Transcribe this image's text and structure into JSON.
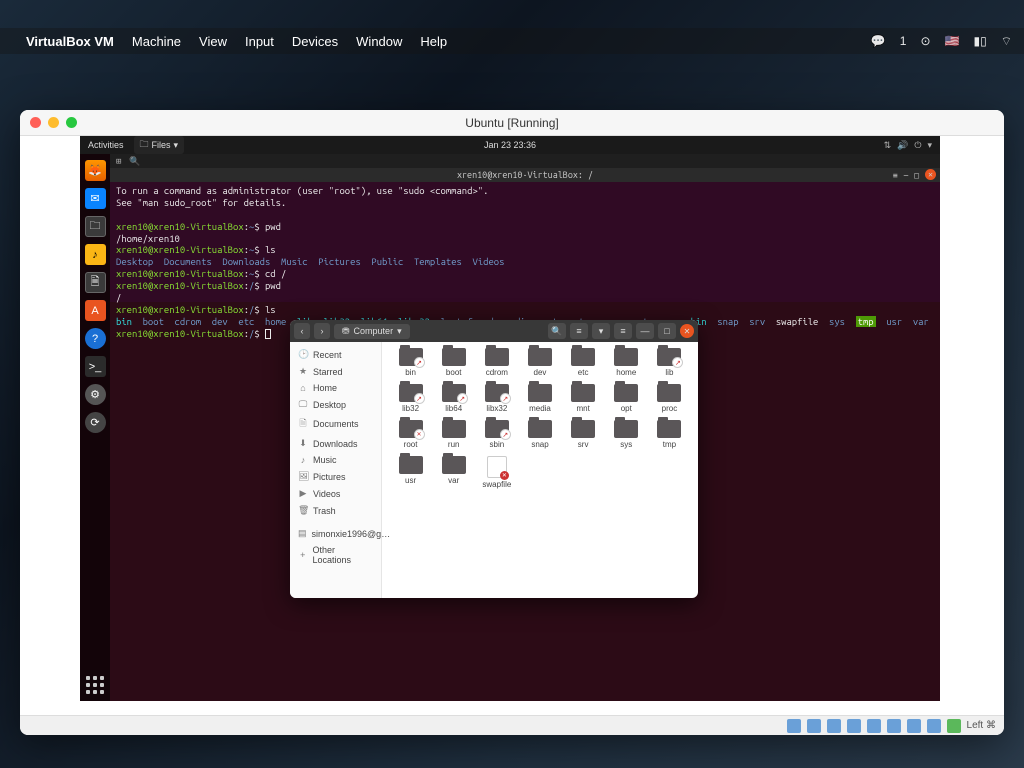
{
  "mac_menu": {
    "app": "VirtualBox VM",
    "items": [
      "Machine",
      "View",
      "Input",
      "Devices",
      "Window",
      "Help"
    ],
    "right_badge": "1"
  },
  "vbox": {
    "title": "Ubuntu [Running]",
    "status_hostkey": "Left ⌘"
  },
  "gnome": {
    "activities": "Activities",
    "files_btn": "Files",
    "clock": "Jan 23  23:36"
  },
  "terminal": {
    "title": "xren10@xren10-VirtualBox: /",
    "hint1": "To run a command as administrator (user \"root\"), use \"sudo <command>\".",
    "hint2": "See \"man sudo_root\" for details.",
    "prompt_userhost": "xren10@xren10-VirtualBox",
    "home_path": "~",
    "root_path": "/",
    "cmd_pwd": "pwd",
    "out_home": "/home/xren10",
    "cmd_ls": "ls",
    "ls_home": [
      "Desktop",
      "Documents",
      "Downloads",
      "Music",
      "Pictures",
      "Public",
      "Templates",
      "Videos"
    ],
    "cmd_cdroot": "cd /",
    "out_root": "/",
    "ls_root_ln": [
      "bin",
      "boot",
      "cdrom",
      "dev",
      "etc"
    ],
    "ls_root_home": "home",
    "ls_root_ln2": [
      "lib",
      "lib32",
      "lib64",
      "libx32"
    ],
    "ls_root_dir": [
      "lost+found",
      "media",
      "mnt",
      "opt",
      "proc",
      "root",
      "run"
    ],
    "ls_root_ln3": "sbin",
    "ls_root_dir2": [
      "snap",
      "srv"
    ],
    "ls_root_swap": "swapfile",
    "ls_root_dir3": "sys",
    "ls_root_tmp": "tmp",
    "ls_root_dir4": [
      "usr",
      "var"
    ]
  },
  "files": {
    "path_label": "Computer",
    "sidebar": [
      {
        "icon": "🕑",
        "label": "Recent"
      },
      {
        "icon": "★",
        "label": "Starred"
      },
      {
        "icon": "⌂",
        "label": "Home"
      },
      {
        "icon": "🖵",
        "label": "Desktop"
      },
      {
        "icon": "🗎",
        "label": "Documents"
      },
      {
        "icon": "⬇",
        "label": "Downloads"
      },
      {
        "icon": "♪",
        "label": "Music"
      },
      {
        "icon": "🖼",
        "label": "Pictures"
      },
      {
        "icon": "▶",
        "label": "Videos"
      },
      {
        "icon": "🗑",
        "label": "Trash"
      },
      {
        "icon": "▤",
        "label": "simonxie1996@g…"
      },
      {
        "icon": "+",
        "label": "Other Locations"
      }
    ],
    "items": [
      {
        "name": "bin",
        "type": "link"
      },
      {
        "name": "boot",
        "type": "folder"
      },
      {
        "name": "cdrom",
        "type": "folder"
      },
      {
        "name": "dev",
        "type": "folder"
      },
      {
        "name": "etc",
        "type": "folder"
      },
      {
        "name": "home",
        "type": "folder"
      },
      {
        "name": "lib",
        "type": "link"
      },
      {
        "name": "lib32",
        "type": "link"
      },
      {
        "name": "lib64",
        "type": "link"
      },
      {
        "name": "libx32",
        "type": "link"
      },
      {
        "name": "media",
        "type": "folder"
      },
      {
        "name": "mnt",
        "type": "folder"
      },
      {
        "name": "opt",
        "type": "folder"
      },
      {
        "name": "proc",
        "type": "folder"
      },
      {
        "name": "root",
        "type": "lock"
      },
      {
        "name": "run",
        "type": "folder"
      },
      {
        "name": "sbin",
        "type": "link"
      },
      {
        "name": "snap",
        "type": "folder"
      },
      {
        "name": "srv",
        "type": "folder"
      },
      {
        "name": "sys",
        "type": "folder"
      },
      {
        "name": "tmp",
        "type": "folder"
      },
      {
        "name": "usr",
        "type": "folder"
      },
      {
        "name": "var",
        "type": "folder"
      },
      {
        "name": "swapfile",
        "type": "file"
      }
    ]
  }
}
